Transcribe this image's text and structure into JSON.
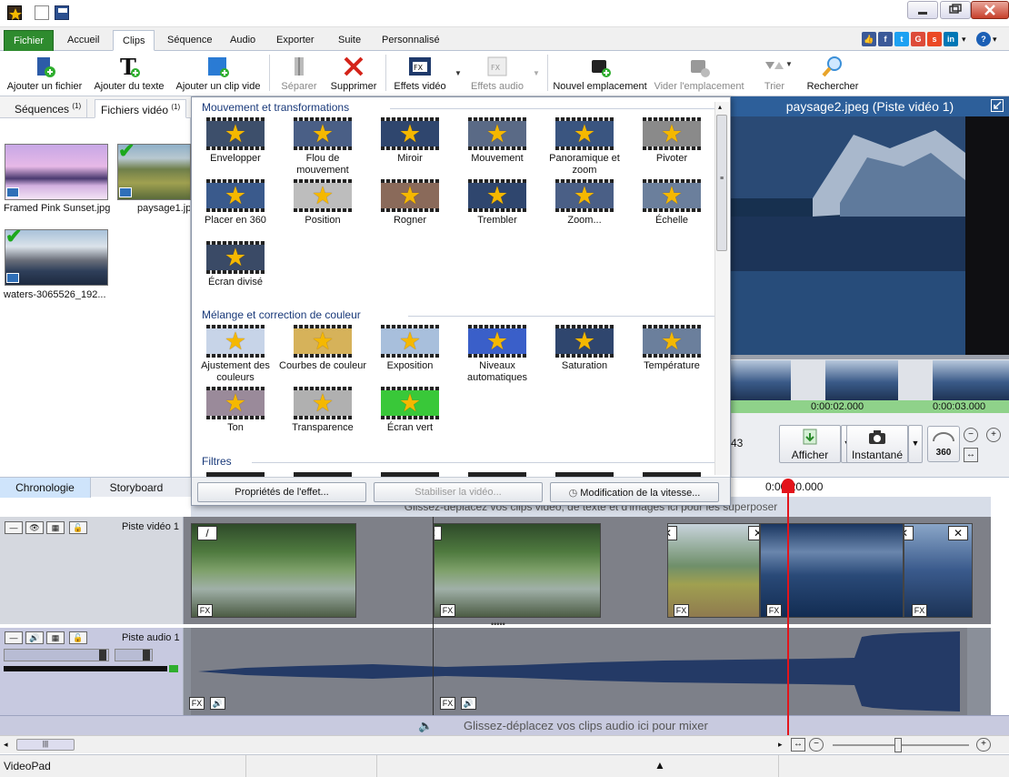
{
  "window": {
    "app_name": "VideoPad"
  },
  "menu": {
    "tabs": [
      "Fichier",
      "Accueil",
      "Clips",
      "Séquence",
      "Audio",
      "Exporter",
      "Suite",
      "Personnalisé"
    ],
    "active": "Clips"
  },
  "toolbar": {
    "add_file": "Ajouter un fichier",
    "add_text": "Ajouter du texte",
    "add_blank": "Ajouter un clip vide",
    "split": "Séparer",
    "delete": "Supprimer",
    "video_effects": "Effets vidéo",
    "audio_effects": "Effets audio",
    "new_placeholder": "Nouvel emplacement",
    "clear_placeholder": "Vider l'emplacement",
    "sort": "Trier",
    "search": "Rechercher"
  },
  "bin": {
    "tab_sequences": "Séquences",
    "tab_sequences_count": "(1)",
    "tab_video_files": "Fichiers vidéo",
    "tab_video_files_count": "(1)",
    "items": [
      {
        "name": "Framed Pink Sunset.jpg"
      },
      {
        "name": "paysage1.jp"
      },
      {
        "name": "waters-3065526_192..."
      }
    ]
  },
  "effects": {
    "sections": [
      {
        "title": "Mouvement et transformations"
      },
      {
        "title": "Mélange et correction de couleur"
      },
      {
        "title": "Filtres"
      }
    ],
    "motion": [
      "Envelopper",
      "Flou de mouvement",
      "Miroir",
      "Mouvement",
      "Panoramique et zoom",
      "Pivoter",
      "Placer en 360",
      "Position",
      "Rogner",
      "Trembler",
      "Zoom...",
      "Échelle",
      "Écran divisé"
    ],
    "color": [
      "Ajustement des couleurs",
      "Courbes de couleur",
      "Exposition",
      "Niveaux automatiques",
      "Saturation",
      "Température",
      "Ton",
      "Transparence",
      "Écran vert"
    ],
    "buttons": {
      "properties": "Propriétés de l'effet...",
      "stabilize": "Stabiliser la vidéo...",
      "speed": "Modification de la vitesse..."
    }
  },
  "preview": {
    "title": "paysage2.jpeg (Piste vidéo 1)",
    "time1": "0:00:02.000",
    "time2": "0:00:03.000",
    "partial_time": "43",
    "show": "Afficher",
    "snapshot": "Instantané",
    "btn360": "360"
  },
  "timeline": {
    "tab_timeline": "Chronologie",
    "tab_storyboard": "Storyboard",
    "time_marker": "0:00:20.000",
    "overlay_hint": "Glissez-déplacez vos clips vidéo, de texte et d'images ici pour les superposer",
    "video_track": "Piste vidéo 1",
    "audio_track": "Piste audio 1",
    "audio_hint": "Glissez-déplacez vos clips audio ici pour mixer",
    "fx": "FX"
  },
  "colors": {
    "accent": "#2d5f9a",
    "file_tab": "#2e8b2e",
    "playhead": "#e3141b"
  }
}
